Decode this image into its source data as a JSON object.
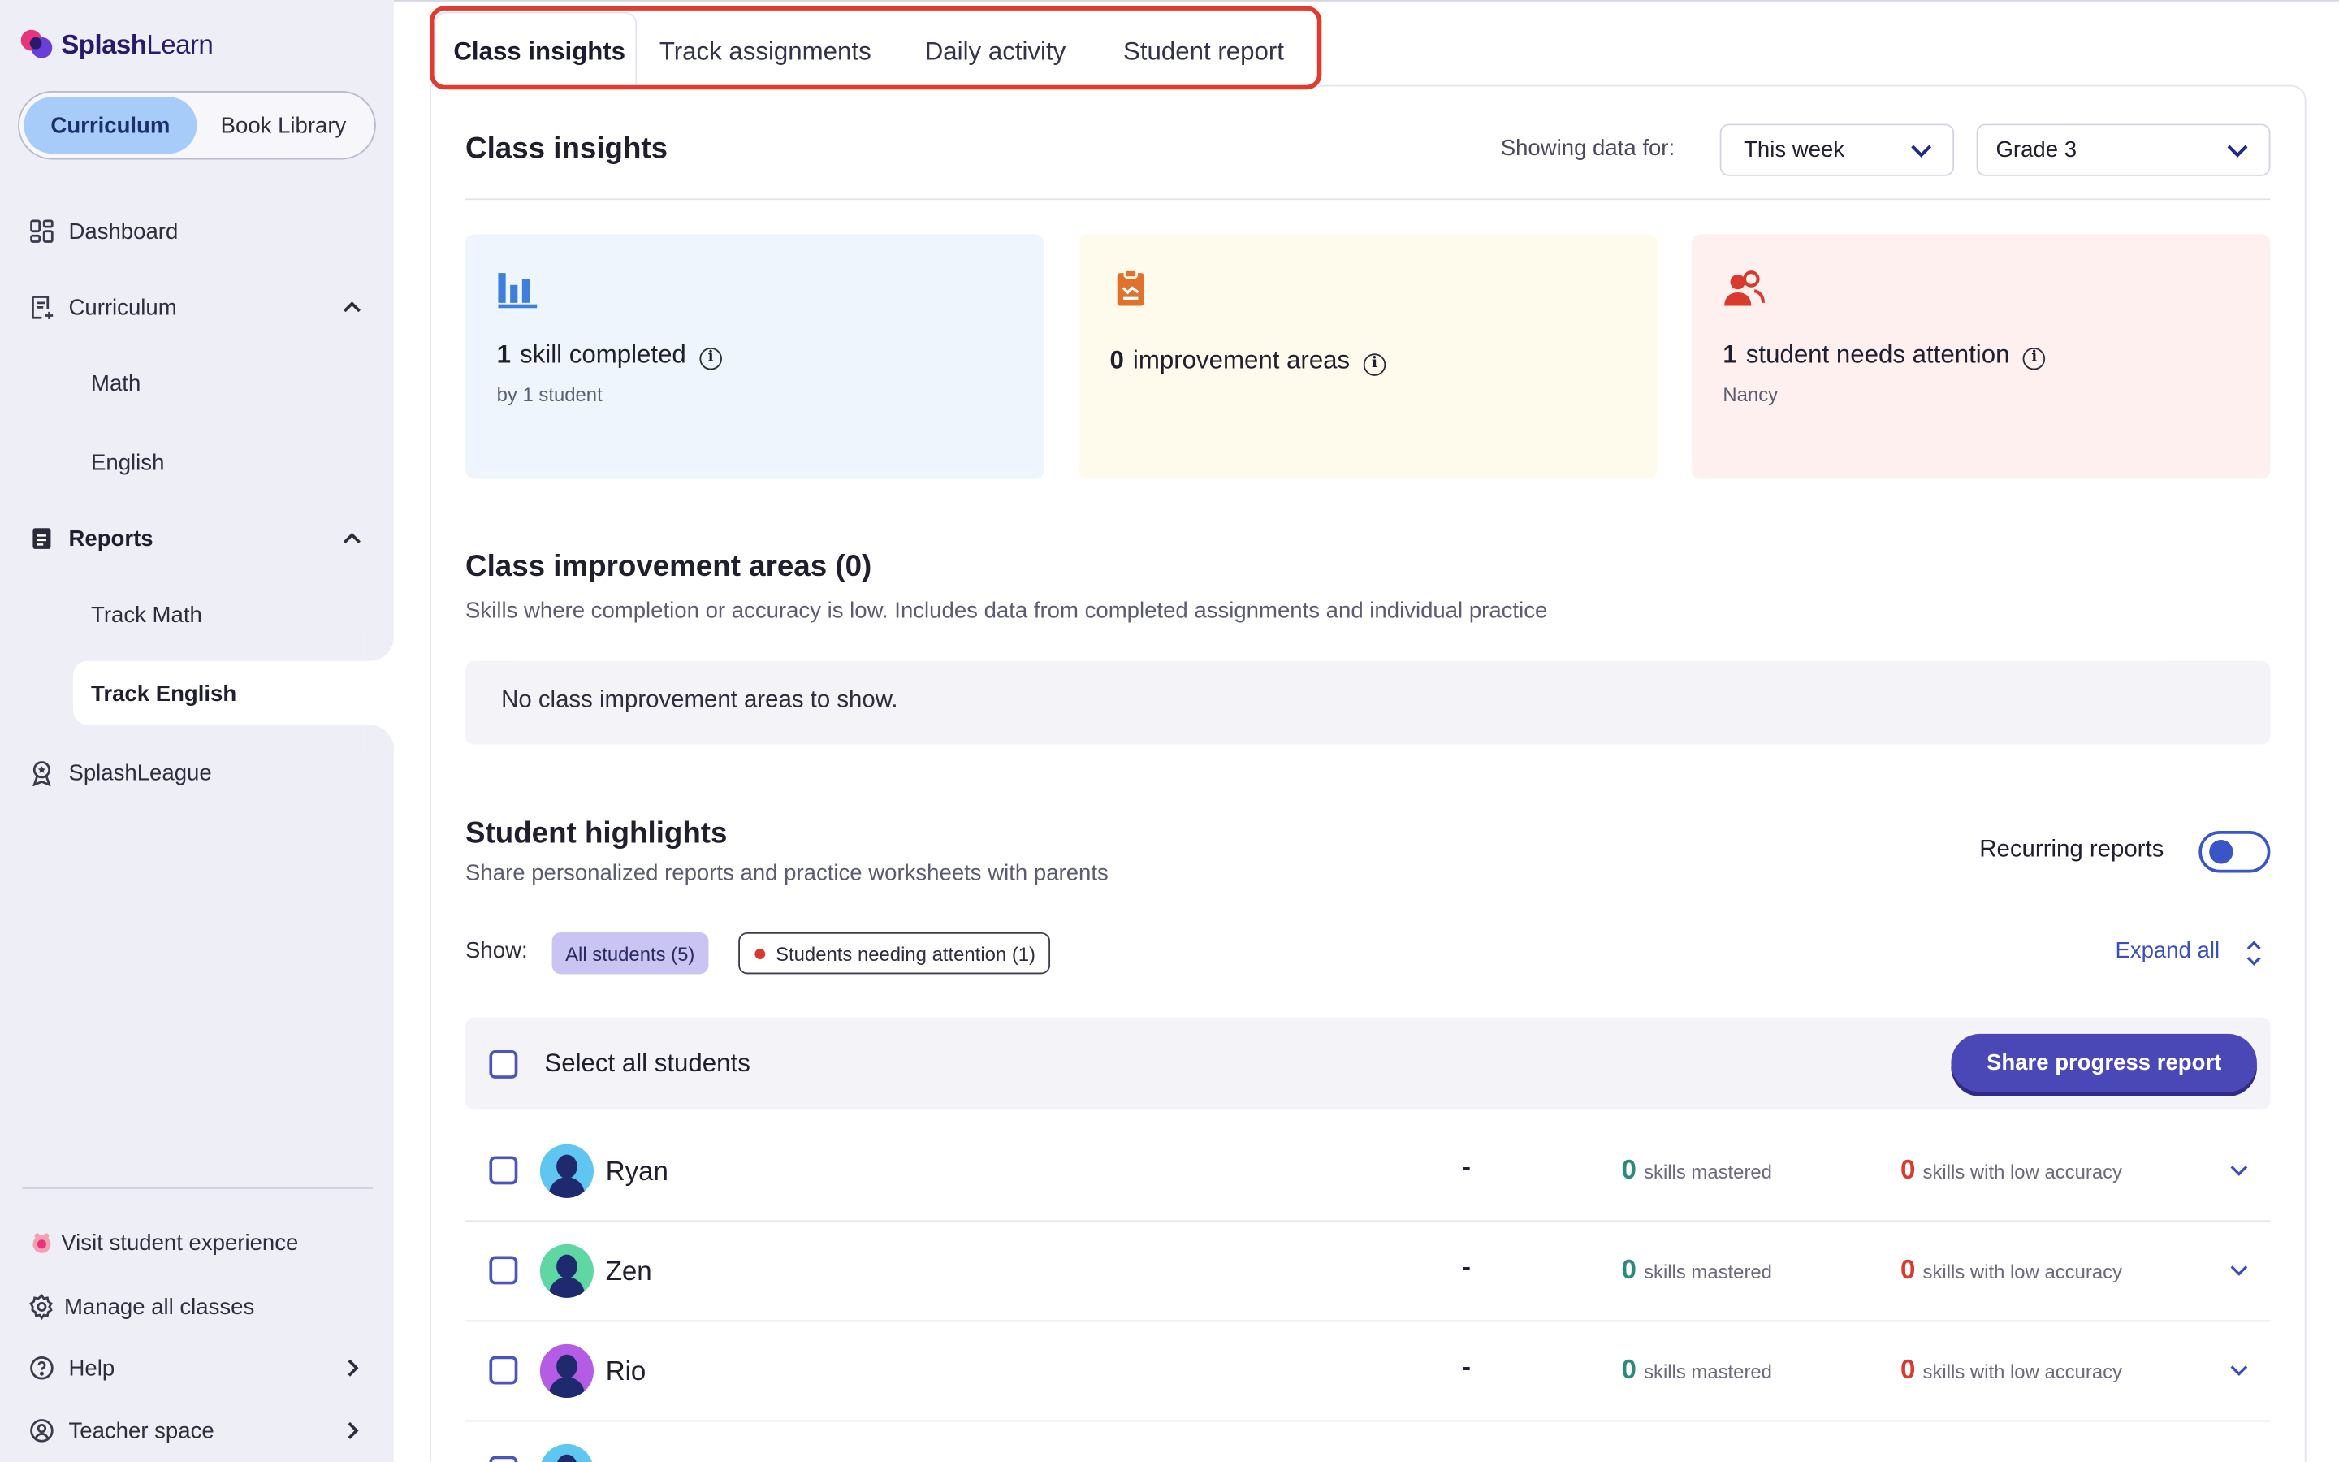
{
  "app": {
    "logo_text_bold": "Splash",
    "logo_text_light": "Learn"
  },
  "sidebar": {
    "toggle": {
      "active": "Curriculum",
      "inactive": "Book Library"
    },
    "items": [
      {
        "label": "Dashboard",
        "icon": "dashboard-icon"
      },
      {
        "label": "Curriculum",
        "icon": "curriculum-icon",
        "expanded": true
      },
      {
        "label": "Math"
      },
      {
        "label": "English"
      },
      {
        "label": "Reports",
        "icon": "reports-icon",
        "expanded": true
      },
      {
        "label": "Track Math"
      },
      {
        "label": "Track English",
        "active": true
      },
      {
        "label": "SplashLeague",
        "icon": "league-icon"
      }
    ],
    "footer": [
      {
        "label": "Visit student experience",
        "icon": "student-experience-icon"
      },
      {
        "label": "Manage all classes",
        "icon": "gear-icon"
      },
      {
        "label": "Help",
        "icon": "help-icon"
      },
      {
        "label": "Teacher space",
        "icon": "teacher-icon"
      }
    ]
  },
  "tabs": [
    {
      "label": "Class insights",
      "active": true
    },
    {
      "label": "Track assignments"
    },
    {
      "label": "Daily activity"
    },
    {
      "label": "Student report"
    }
  ],
  "insights": {
    "title": "Class insights",
    "showing_label": "Showing data for:",
    "period": "This week",
    "grade": "Grade 3",
    "cards": [
      {
        "value": "1",
        "label": "skill completed",
        "sub": "by 1 student",
        "bg": "#eef5fd",
        "icon": "bar-chart-icon",
        "color": "#3d7fd9"
      },
      {
        "value": "0",
        "label": "improvement areas",
        "sub": "",
        "bg": "#fefaec",
        "icon": "clipboard-icon",
        "color": "#e0722e"
      },
      {
        "value": "1",
        "label": "student needs attention",
        "sub": "Nancy",
        "bg": "#fdf0ef",
        "icon": "users-icon",
        "color": "#d93a2e"
      }
    ]
  },
  "improvement": {
    "title": "Class improvement areas (0)",
    "subtitle": "Skills where completion or accuracy is low. Includes data from completed assignments and individual practice",
    "empty": "No class improvement areas to show."
  },
  "highlights": {
    "title": "Student highlights",
    "subtitle": "Share personalized reports and practice worksheets with parents",
    "recurring_label": "Recurring reports",
    "show_label": "Show:",
    "filter_all": "All students (5)",
    "filter_attention": "Students needing attention (1)",
    "expand_all": "Expand all",
    "select_all": "Select all students",
    "share_button": "Share progress report",
    "mastered_label": "skills mastered",
    "low_label": "skills with low accuracy",
    "students": [
      {
        "name": "Ryan",
        "score": "-",
        "mastered": "0",
        "low": "0",
        "avatar_color": "#5fc6f2"
      },
      {
        "name": "Zen",
        "score": "-",
        "mastered": "0",
        "low": "0",
        "avatar_color": "#5ed7a3"
      },
      {
        "name": "Rio",
        "score": "-",
        "mastered": "0",
        "low": "0",
        "avatar_color": "#b45ce3"
      }
    ]
  }
}
